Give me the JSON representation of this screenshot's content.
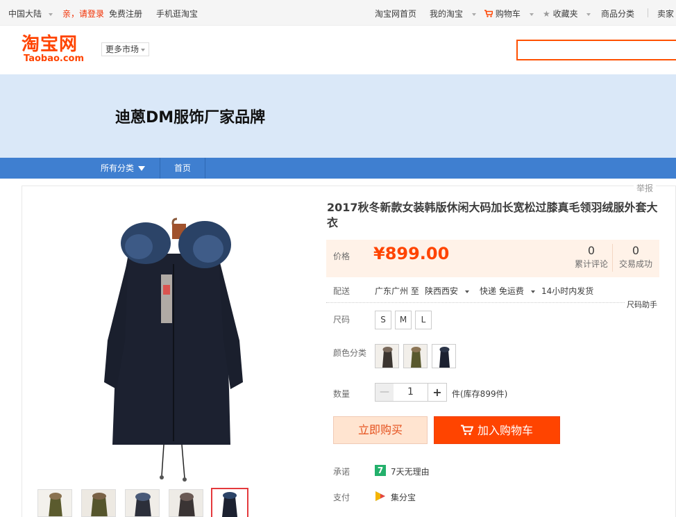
{
  "topbar": {
    "region": "中国大陆",
    "greeting": "亲，请登录",
    "register": "免费注册",
    "mobile": "手机逛淘宝",
    "home": "淘宝网首页",
    "my_taobao": "我的淘宝",
    "cart": "购物车",
    "favorites": "收藏夹",
    "categories": "商品分类",
    "seller": "卖家"
  },
  "header": {
    "logo_cn": "淘宝网",
    "logo_en": "Taobao.com",
    "more_market": "更多市场"
  },
  "shop": {
    "name": "迪蒽DM服饰厂家品牌",
    "nav_all": "所有分类",
    "nav_home": "首页"
  },
  "product": {
    "report": "举报",
    "title": "2017秋冬新款女装韩版休闲大码加长宽松过膝真毛领羽绒服外套大衣",
    "price_label": "价格",
    "price": "¥899.00",
    "reviews_count": "0",
    "reviews_label": "累计评论",
    "sales_count": "0",
    "sales_label": "交易成功",
    "shipping_label": "配送",
    "ship_from": "广东广州 至",
    "ship_to": "陕西西安",
    "ship_method": "快递 免运费",
    "ship_time": "14小时内发货",
    "size_helper": "尺码助手",
    "size_label": "尺码",
    "sizes": [
      "S",
      "M",
      "L"
    ],
    "color_label": "颜色分类",
    "qty_label": "数量",
    "qty_value": "1",
    "stock": "件(库存899件)",
    "buy_now": "立即购买",
    "add_cart": "加入购物车",
    "promise_label": "承诺",
    "promise_icon": "7",
    "promise_text": "7天无理由",
    "pay_label": "支付",
    "pay_text": "集分宝"
  },
  "colors": {
    "accent": "#ff4400",
    "banner_bg": "#dae8f8",
    "nav_bg": "#3f7fd0",
    "price_bg": "#fff2e8"
  }
}
